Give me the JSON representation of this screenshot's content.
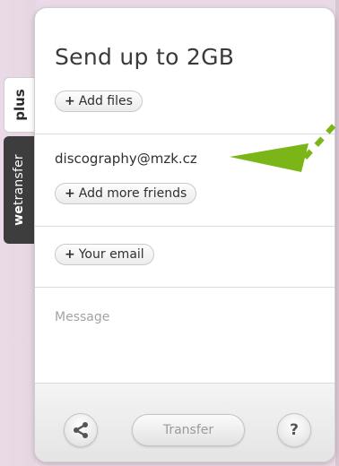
{
  "side_tabs": {
    "plus_label": "plus",
    "brand_bold": "we",
    "brand_rest": "transfer"
  },
  "panel": {
    "title": "Send up to 2GB",
    "add_files_label": "Add files",
    "recipient_email": "discography@mzk.cz",
    "add_friends_label": "Add more friends",
    "your_email_label": "Your email",
    "message_placeholder": "Message",
    "plus_glyph": "+"
  },
  "footer": {
    "transfer_label": "Transfer",
    "help_label": "?"
  },
  "icons": {
    "share": "share-icon",
    "arrow": "arrow-pointer-icon"
  },
  "colors": {
    "accent_arrow": "#7cb518",
    "tab_dark": "#3d3d3d",
    "background": "#ead9e6"
  }
}
